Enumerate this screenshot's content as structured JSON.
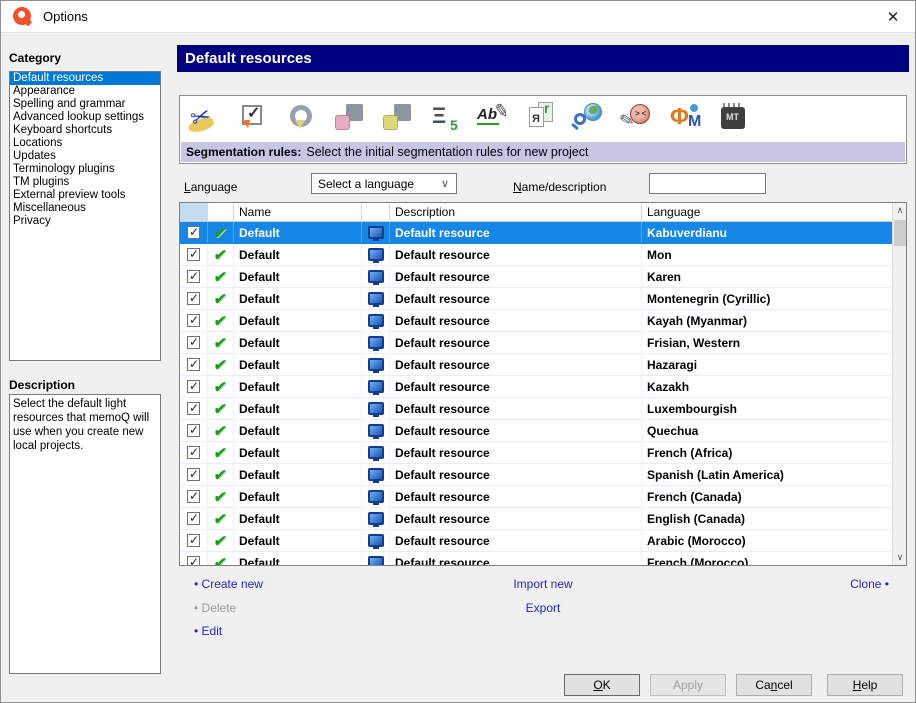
{
  "window": {
    "title": "Options",
    "close_glyph": "✕"
  },
  "sidebar": {
    "category_label": "Category",
    "items": [
      "Default resources",
      "Appearance",
      "Spelling and grammar",
      "Advanced lookup settings",
      "Keyboard shortcuts",
      "Locations",
      "Updates",
      "Terminology plugins",
      "TM plugins",
      "External preview tools",
      "Miscellaneous",
      "Privacy"
    ],
    "selected_index": 0,
    "description_label": "Description",
    "description_text": "Select the default light resources that memoQ will use when you create new local projects."
  },
  "main": {
    "header": "Default resources",
    "toolbar": {
      "icons": [
        {
          "name": "segmentation-rules-icon",
          "cls": "ic-seg"
        },
        {
          "name": "qa-settings-icon",
          "cls": "ic-qa"
        },
        {
          "name": "tm-settings-icon",
          "cls": "ic-tm"
        },
        {
          "name": "filter-configurations-icon",
          "cls": "ic-puz ic-filter"
        },
        {
          "name": "export-path-rules-icon",
          "cls": "ic-puz ic-export"
        },
        {
          "name": "auto-translation-rules-icon",
          "cls": "ic-auto"
        },
        {
          "name": "ignore-lists-icon",
          "cls": "ic-ign"
        },
        {
          "name": "transliteration-rules-icon",
          "cls": "ic-tr"
        },
        {
          "name": "web-search-settings-icon",
          "cls": "ic-web"
        },
        {
          "name": "lqa-models-icon",
          "cls": "ic-lqa"
        },
        {
          "name": "font-substitution-icon",
          "cls": "ic-fnt"
        },
        {
          "name": "mt-settings-icon",
          "cls": "ic-mt"
        }
      ],
      "selected_label": "Segmentation rules:",
      "selected_hint": "Select the initial segmentation rules for new project"
    },
    "filters": {
      "language_label_u": "L",
      "language_label_rest": "anguage",
      "language_value": "Select a language",
      "combo_chevron": "∨",
      "name_label_u": "N",
      "name_label_rest": "ame/description",
      "name_value": ""
    },
    "table": {
      "columns": {
        "name": "Name",
        "description": "Description",
        "language": "Language"
      },
      "rows": [
        {
          "checked": true,
          "enabled": true,
          "name": "Default",
          "description": "Default resource",
          "language": "Kabuverdianu",
          "selected": true
        },
        {
          "checked": true,
          "enabled": true,
          "name": "Default",
          "description": "Default resource",
          "language": "Mon",
          "selected": false
        },
        {
          "checked": true,
          "enabled": true,
          "name": "Default",
          "description": "Default resource",
          "language": "Karen",
          "selected": false
        },
        {
          "checked": true,
          "enabled": true,
          "name": "Default",
          "description": "Default resource",
          "language": "Montenegrin (Cyrillic)",
          "selected": false
        },
        {
          "checked": true,
          "enabled": true,
          "name": "Default",
          "description": "Default resource",
          "language": "Kayah (Myanmar)",
          "selected": false
        },
        {
          "checked": true,
          "enabled": true,
          "name": "Default",
          "description": "Default resource",
          "language": "Frisian, Western",
          "selected": false
        },
        {
          "checked": true,
          "enabled": true,
          "name": "Default",
          "description": "Default resource",
          "language": "Hazaragi",
          "selected": false
        },
        {
          "checked": true,
          "enabled": true,
          "name": "Default",
          "description": "Default resource",
          "language": "Kazakh",
          "selected": false
        },
        {
          "checked": true,
          "enabled": true,
          "name": "Default",
          "description": "Default resource",
          "language": "Luxembourgish",
          "selected": false
        },
        {
          "checked": true,
          "enabled": true,
          "name": "Default",
          "description": "Default resource",
          "language": "Quechua",
          "selected": false
        },
        {
          "checked": true,
          "enabled": true,
          "name": "Default",
          "description": "Default resource",
          "language": "French (Africa)",
          "selected": false
        },
        {
          "checked": true,
          "enabled": true,
          "name": "Default",
          "description": "Default resource",
          "language": "Spanish (Latin America)",
          "selected": false
        },
        {
          "checked": true,
          "enabled": true,
          "name": "Default",
          "description": "Default resource",
          "language": "French (Canada)",
          "selected": false
        },
        {
          "checked": true,
          "enabled": true,
          "name": "Default",
          "description": "Default resource",
          "language": "English (Canada)",
          "selected": false
        },
        {
          "checked": true,
          "enabled": true,
          "name": "Default",
          "description": "Default resource",
          "language": "Arabic (Morocco)",
          "selected": false
        },
        {
          "checked": true,
          "enabled": true,
          "name": "Default",
          "description": "Default resource",
          "language": "French (Morocco)",
          "selected": false
        }
      ],
      "scroll_up_glyph": "∧",
      "scroll_down_glyph": "∨"
    },
    "links": {
      "bullet": "•",
      "create_new": "Create new",
      "import_new": "Import new",
      "clone": "Clone",
      "delete": "Delete",
      "export": "Export",
      "edit": "Edit"
    },
    "buttons": {
      "ok_u": "O",
      "ok_rest": "K",
      "apply": "Apply",
      "cancel_pre": "Ca",
      "cancel_u": "n",
      "cancel_rest": "cel",
      "help_u": "H",
      "help_rest": "elp"
    }
  }
}
